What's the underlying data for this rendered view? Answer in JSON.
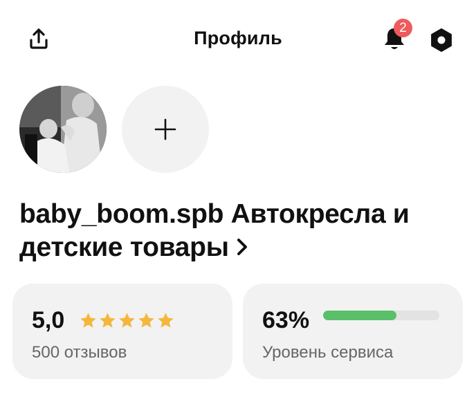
{
  "header": {
    "title": "Профиль",
    "notifications_count": "2"
  },
  "shop": {
    "name": "baby_boom.spb Автокресла и детские товары"
  },
  "rating": {
    "value": "5,0",
    "stars": 5,
    "reviews": "500 отзывов",
    "star_color": "#f5b63c"
  },
  "service": {
    "value": "63%",
    "level": 0.63,
    "label": "Уровень сервиса",
    "bar_color": "#5bbf6a"
  },
  "colors": {
    "badge": "#ef5a5a",
    "card_bg": "#f2f2f2"
  },
  "icons": [
    "share-icon",
    "bell-icon",
    "settings-icon",
    "plus-icon",
    "chevron-right-icon",
    "star-icon"
  ]
}
